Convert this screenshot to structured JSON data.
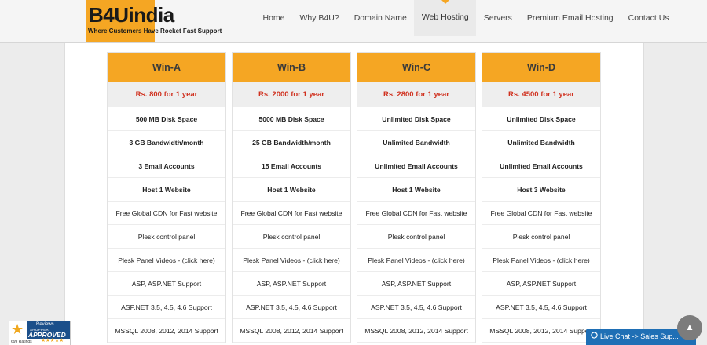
{
  "logo": {
    "name": "B4Uindia",
    "tagline": "Where Customers Have Rocket Fast Support"
  },
  "nav": [
    {
      "label": "Home"
    },
    {
      "label": "Why B4U?"
    },
    {
      "label": "Domain Name"
    },
    {
      "label": "Web Hosting",
      "active": true
    },
    {
      "label": "Servers"
    },
    {
      "label": "Premium Email Hosting"
    },
    {
      "label": "Contact Us"
    }
  ],
  "plans": [
    {
      "name": "Win-A",
      "price": "Rs. 800 for 1 year",
      "features": [
        "500 MB Disk Space",
        "3 GB Bandwidth/month",
        "3 Email Accounts",
        "Host 1 Website",
        "Free Global CDN for Fast website",
        "Plesk control panel",
        "Plesk Panel Videos - (click here)",
        "ASP, ASP.NET Support",
        "ASP.NET 3.5, 4.5, 4.6 Support",
        "MSSQL 2008, 2012, 2014 Support"
      ]
    },
    {
      "name": "Win-B",
      "price": "Rs. 2000 for 1 year",
      "features": [
        "5000 MB Disk Space",
        "25 GB Bandwidth/month",
        "15 Email Accounts",
        "Host 1 Website",
        "Free Global CDN for Fast website",
        "Plesk control panel",
        "Plesk Panel Videos - (click here)",
        "ASP, ASP.NET Support",
        "ASP.NET 3.5, 4.5, 4.6 Support",
        "MSSQL 2008, 2012, 2014 Support"
      ]
    },
    {
      "name": "Win-C",
      "price": "Rs. 2800 for 1 year",
      "features": [
        "Unlimited Disk Space",
        "Unlimited Bandwidth",
        "Unlimited Email Accounts",
        "Host 1 Website",
        "Free Global CDN for Fast website",
        "Plesk control panel",
        "Plesk Panel Videos - (click here)",
        "ASP, ASP.NET Support",
        "ASP.NET 3.5, 4.5, 4.6 Support",
        "MSSQL 2008, 2012, 2014 Support"
      ]
    },
    {
      "name": "Win-D",
      "price": "Rs. 4500 for 1 year",
      "features": [
        "Unlimited Disk Space",
        "Unlimited Bandwidth",
        "Unlimited Email Accounts",
        "Host 3 Website",
        "Free Global CDN for Fast website",
        "Plesk control panel",
        "Plesk Panel Videos - (click here)",
        "ASP, ASP.NET Support",
        "ASP.NET 3.5, 4.5, 4.6 Support",
        "MSSQL 2008, 2012, 2014 Support"
      ]
    }
  ],
  "badge": {
    "reviews": "Reviews",
    "shopper": "SHOPPER",
    "approved": "APPROVED",
    "ratings": "699 Ratings",
    "stars": "★★★★★"
  },
  "chat": {
    "label": "Live Chat -> Sales Sup...",
    "icon": "chat-bubble-icon"
  },
  "scroll_top": {
    "icon": "arrow-up-icon",
    "glyph": "▲"
  },
  "colors": {
    "accent": "#f5a623",
    "price": "#d0311f",
    "chat": "#1f6fb5"
  }
}
